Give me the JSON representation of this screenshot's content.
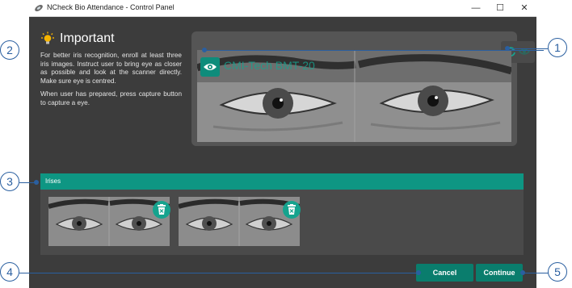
{
  "window": {
    "title": "NCheck Bio Attendance - Control Panel",
    "controls": {
      "minimize": "—",
      "maximize": "☐",
      "close": "✕"
    }
  },
  "important": {
    "title": "Important",
    "paragraph1": "For better iris recognition, enroll at least three iris images. Instruct user to bring eye as closer as possible and look at the scanner directly. Make sure eye is centred.",
    "paragraph2": "When user has prepared, press capture button to capture a eye."
  },
  "scanner": {
    "device_name": "CMI-Tech BMT-20",
    "icons": [
      "eye-icon",
      "refresh-icon",
      "eye-toggle-icon"
    ]
  },
  "irises": {
    "label": "Irises",
    "items": [
      {
        "name": "iris-thumbnail-1",
        "icon": "delete-icon"
      },
      {
        "name": "iris-thumbnail-2",
        "icon": "delete-icon"
      }
    ]
  },
  "actions": {
    "cancel": "Cancel",
    "continue": "Continue"
  },
  "callouts": [
    "1",
    "2",
    "3",
    "4",
    "5"
  ],
  "colors": {
    "accent": "#0e9683",
    "button": "#0a7d6d",
    "callout": "#2a5fa0"
  }
}
